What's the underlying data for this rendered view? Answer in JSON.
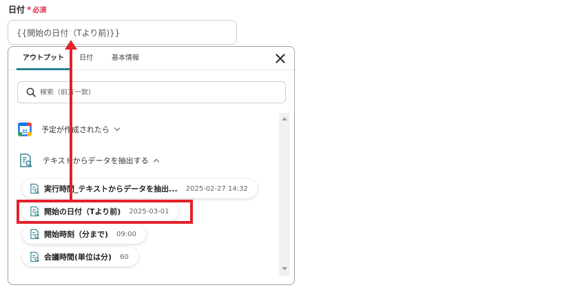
{
  "field": {
    "label": "日付",
    "required_star": "*",
    "required_text": "必須",
    "value": "{{開始の日付（Tより前)}}"
  },
  "tabs": [
    {
      "label": "アウトプット",
      "active": true
    },
    {
      "label": "日付",
      "active": false
    },
    {
      "label": "基本情報",
      "active": false
    }
  ],
  "search": {
    "placeholder": "検索（前方一致)"
  },
  "groups": [
    {
      "label": "予定が作成されたら",
      "expanded": false,
      "icon": "google-calendar-icon"
    },
    {
      "label": "テキストからデータを抽出する",
      "expanded": true,
      "icon": "text-extract-icon"
    }
  ],
  "items": [
    {
      "name": "実行時間_テキストからデータを抽出...",
      "value": "2025-02-27 14:32"
    },
    {
      "name": "開始の日付（Tより前)",
      "value": "2025-03-01"
    },
    {
      "name": "開始時刻（分まで)",
      "value": "09:00"
    },
    {
      "name": "会議時間(単位は分)",
      "value": "60"
    }
  ],
  "colors": {
    "accent": "#2a7f8f",
    "required": "#e0294a",
    "annotation": "#e3202b"
  }
}
